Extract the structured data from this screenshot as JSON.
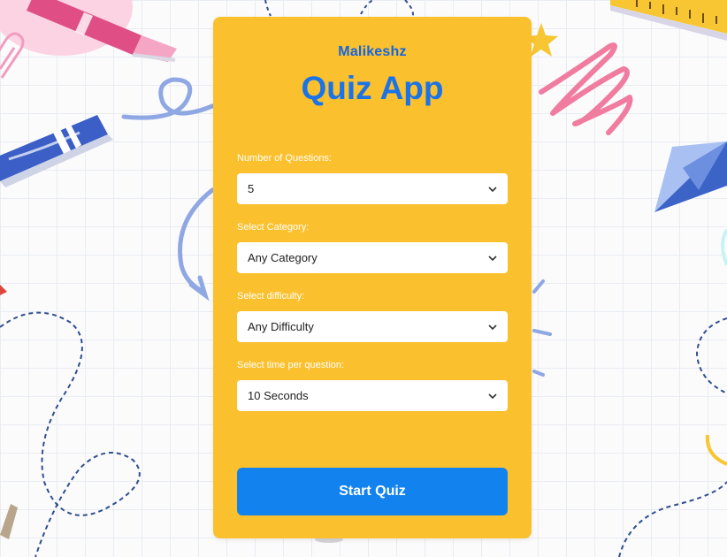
{
  "app": {
    "author": "Malikeshz",
    "title": "Quiz App"
  },
  "form": {
    "num_questions": {
      "label": "Number of Questions:",
      "value": "5"
    },
    "category": {
      "label": "Select Category:",
      "value": "Any Category"
    },
    "difficulty": {
      "label": "Select difficulty:",
      "value": "Any Difficulty"
    },
    "time": {
      "label": "Select time per question:",
      "value": "10 Seconds"
    }
  },
  "start_button": {
    "label": "Start Quiz"
  },
  "colors": {
    "card": "#fbc02d",
    "accent_blue": "#1a73e8",
    "button": "#1283ee"
  },
  "icons": [
    "crayon-icon",
    "paperclip-icon",
    "star-icon",
    "paper-plane-icon",
    "ruler-icon",
    "scribble-icon"
  ]
}
